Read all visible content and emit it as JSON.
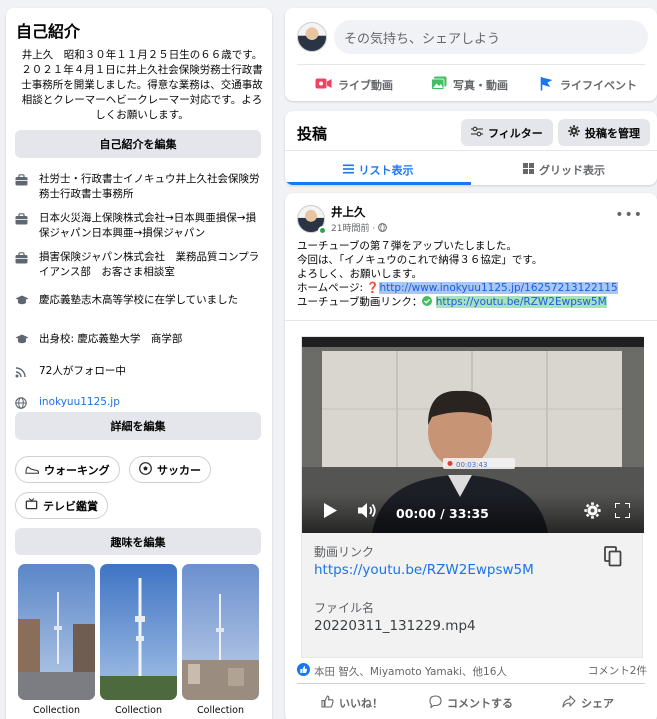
{
  "intro": {
    "title": "自己紹介",
    "bio": "井上久　昭和３０年１１月２５日生の６６歳です。２０２１年４月１日に井上久社会保険労務士行政書士事務所を開業しました。得意な業務は、交通事故相談とクレーマーヘビークレーマー対応です。よろしくお願いします。",
    "edit_intro_label": "自己紹介を編集",
    "items": [
      {
        "icon": "briefcase-icon",
        "text": "社労士・行政書士イノキュウ井上久社会保険労務士行政書士事務所"
      },
      {
        "icon": "briefcase-icon",
        "text": "日本火災海上保険株式会社→日本興亜損保→損保ジャパン日本興亜→損保ジャパン"
      },
      {
        "icon": "briefcase-icon",
        "text": "損害保険ジャパン株式会社　業務品質コンプライアンス部　お客さま相談室"
      },
      {
        "icon": "graduation-cap-icon",
        "text": "慶応義塾志木高等学校に在学していました"
      },
      {
        "icon": "graduation-cap-icon",
        "text": "出身校: 慶応義塾大学　商学部"
      },
      {
        "icon": "rss-icon",
        "text": "72人がフォロー中"
      },
      {
        "icon": "globe-icon",
        "text": "inokyuu1125.jp"
      }
    ],
    "edit_details_label": "詳細を編集",
    "hobbies": [
      {
        "icon": "sneaker-icon",
        "label": "ウォーキング"
      },
      {
        "icon": "soccer-ball-icon",
        "label": "サッカー"
      },
      {
        "icon": "tv-icon",
        "label": "テレビ鑑賞"
      }
    ],
    "edit_hobbies_label": "趣味を編集",
    "collections": [
      "Collection",
      "Collection",
      "Collection"
    ]
  },
  "composer": {
    "placeholder": "その気持ち、シェアしよう",
    "actions": [
      {
        "icon": "live-video-icon",
        "label": "ライブ動画",
        "color": "#f3425f"
      },
      {
        "icon": "photo-video-icon",
        "label": "写真・動画",
        "color": "#45bd62"
      },
      {
        "icon": "life-event-flag-icon",
        "label": "ライフイベント",
        "color": "#1877f2"
      }
    ]
  },
  "posts_header": {
    "title": "投稿",
    "filter_label": "フィルター",
    "manage_label": "投稿を管理",
    "tabs": [
      {
        "label": "リスト表示",
        "active": true
      },
      {
        "label": "グリッド表示",
        "active": false
      }
    ]
  },
  "post": {
    "author": "井上久",
    "time": "21時間前",
    "lines": [
      "ユーチューブの第７弾をアップいたしました。",
      "今回は、「イノキュウのこれで納得３６協定」です。",
      "よろしく、お願いします。"
    ],
    "homepage_prefix": "ホームページ: ",
    "homepage_url": "http://www.inokyuu1125.jp/16257213122115",
    "youtube_prefix": "ユーチューブ動画リンク：",
    "youtube_url": "https://youtu.be/RZW2Ewpsw5M",
    "player_time": "00:00 / 33:35",
    "player_small_time": "00:03:43",
    "video_link_label": "動画リンク",
    "video_link": "https://youtu.be/RZW2Ewpsw5M",
    "file_name_label": "ファイル名",
    "file_name": "20220311_131229.mp4",
    "reactions": "本田 智久、Miyamoto Yamaki、他16人",
    "comments_count": "コメント2件",
    "actions": [
      "いいね！",
      "コメントする",
      "シェア"
    ],
    "accent_color": "#1877f2"
  }
}
